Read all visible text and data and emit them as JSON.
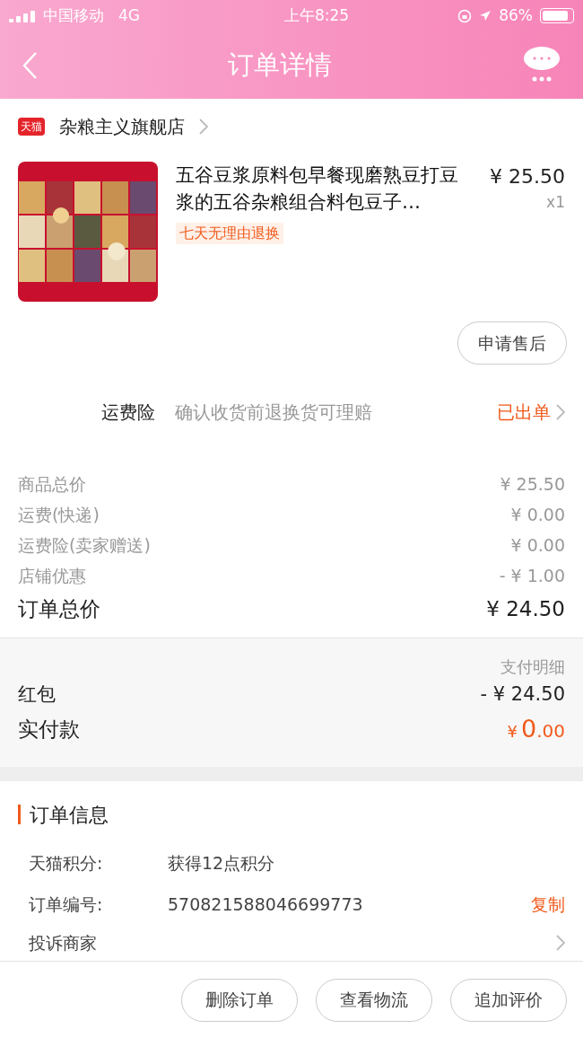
{
  "status_bar": {
    "carrier": "中国移动",
    "network": "4G",
    "time": "上午8:25",
    "battery": "86%"
  },
  "nav": {
    "title": "订单详情"
  },
  "shop": {
    "badge": "天猫",
    "name": "杂粮主义旗舰店"
  },
  "product": {
    "title": "五谷豆浆原料包早餐现磨熟豆打豆浆的五谷杂粮组合料包豆子…",
    "price": "¥ 25.50",
    "quantity": "x1",
    "tag": "七天无理由退换",
    "action": "申请售后"
  },
  "insurance": {
    "label": "运费险",
    "description": "确认收货前退换货可理赔",
    "status": "已出单"
  },
  "price_rows": [
    {
      "label": "商品总价",
      "value": "¥ 25.50",
      "kind": "normal"
    },
    {
      "label": "运费(快递)",
      "value": "¥ 0.00",
      "kind": "normal"
    },
    {
      "label": "运费险(卖家赠送)",
      "value": "¥ 0.00",
      "kind": "normal"
    },
    {
      "label": "店铺优惠",
      "value": "- ¥ 1.00",
      "kind": "normal"
    },
    {
      "label": "订单总价",
      "value": "¥ 24.50",
      "kind": "total"
    }
  ],
  "payment": {
    "detail_link": "支付明细",
    "red_packet_label": "红包",
    "red_packet_value": "- ¥ 24.50",
    "paid_label": "实付款",
    "paid_currency": "¥",
    "paid_integer": "0",
    "paid_decimal": ".00"
  },
  "order_info": {
    "title": "订单信息",
    "rows": [
      {
        "label": "天猫积分:",
        "value": "获得12点积分"
      },
      {
        "label": "订单编号:",
        "value": "570821588046699773",
        "action": "复制"
      }
    ],
    "complaint": "投诉商家"
  },
  "bottom_buttons": [
    "删除订单",
    "查看物流",
    "追加评价"
  ]
}
